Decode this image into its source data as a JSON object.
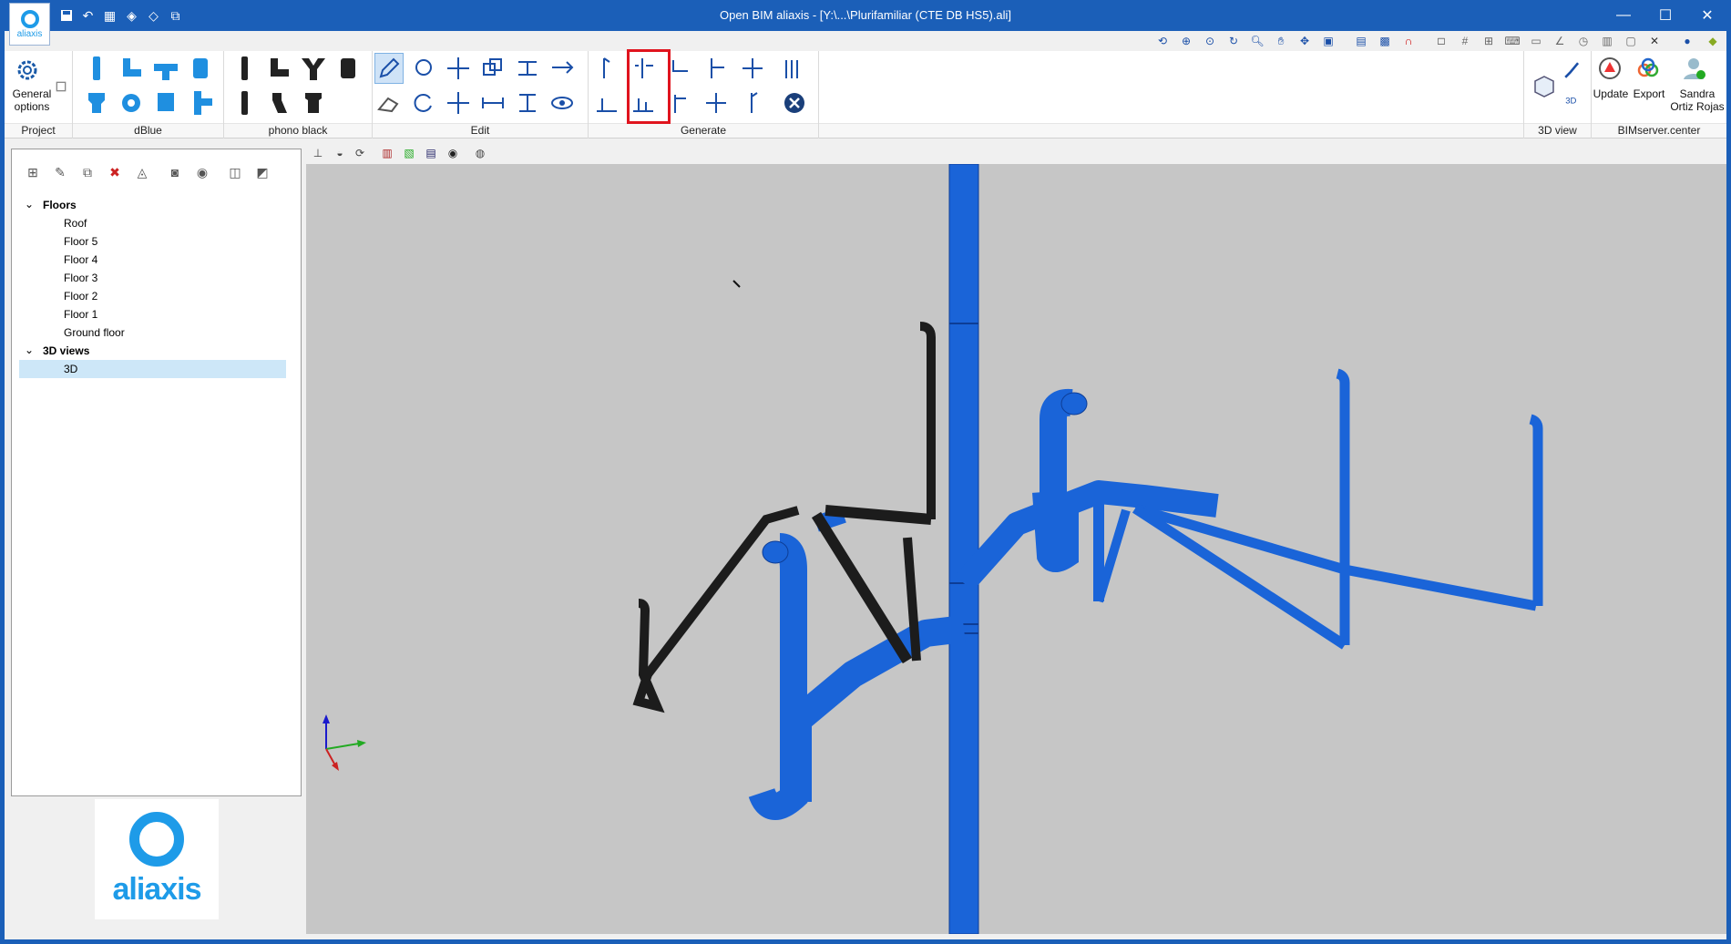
{
  "window": {
    "title": "Open BIM aliaxis - [Y:\\...\\Plurifamiliar (CTE DB HS5).ali]",
    "logo_text": "aliaxis",
    "controls": {
      "minimize": "—",
      "maximize": "☐",
      "close": "✕"
    }
  },
  "ribbon": {
    "groups": [
      {
        "label": "Project"
      },
      {
        "label": "dBlue"
      },
      {
        "label": "phono black"
      },
      {
        "label": "Edit"
      },
      {
        "label": "Generate"
      },
      {
        "label": "3D view"
      },
      {
        "label": "BIMserver.center"
      }
    ],
    "general_options": "General options",
    "update": "Update",
    "export": "Export",
    "user": "Sandra Ortiz Rojas"
  },
  "tree": {
    "floors_header": "Floors",
    "floors": [
      "Roof",
      "Floor 5",
      "Floor 4",
      "Floor 3",
      "Floor 2",
      "Floor 1",
      "Ground floor"
    ],
    "views_header": "3D views",
    "views": [
      "3D"
    ]
  },
  "brand": {
    "text": "aliaxis"
  },
  "colors": {
    "accent": "#1b5fb8",
    "pipe_blue": "#1a64d8",
    "pipe_black": "#1c1c1c",
    "viewport_bg": "#c6c6c6",
    "highlight": "#e0141e"
  }
}
